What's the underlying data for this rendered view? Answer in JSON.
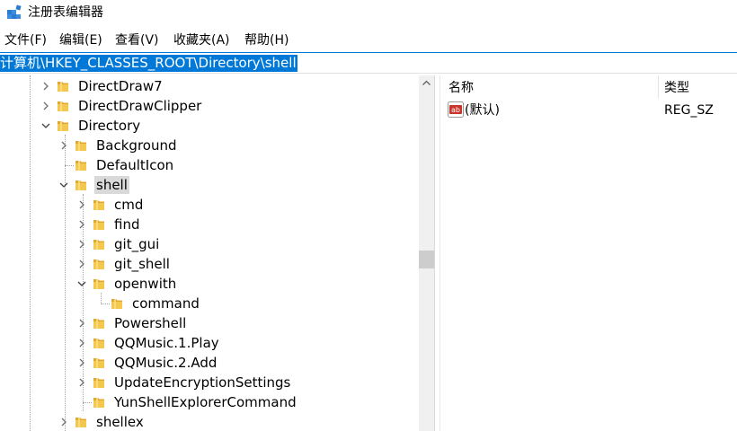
{
  "window": {
    "title": "注册表编辑器"
  },
  "menu": [
    "文件(F)",
    "编辑(E)",
    "查看(V)",
    "收藏夹(A)",
    "帮助(H)"
  ],
  "address": {
    "path": "计算机\\HKEY_CLASSES_ROOT\\Directory\\shell"
  },
  "tree": [
    {
      "label": "DirectDraw7",
      "expander": "collapsed",
      "level": 0
    },
    {
      "label": "DirectDrawClipper",
      "expander": "collapsed",
      "level": 0
    },
    {
      "label": "Directory",
      "expander": "expanded",
      "level": 0
    },
    {
      "label": "Background",
      "expander": "collapsed",
      "level": 1
    },
    {
      "label": "DefaultIcon",
      "expander": "none",
      "level": 1
    },
    {
      "label": "shell",
      "expander": "expanded",
      "level": 1,
      "selected": true
    },
    {
      "label": "cmd",
      "expander": "collapsed",
      "level": 2
    },
    {
      "label": "find",
      "expander": "collapsed",
      "level": 2
    },
    {
      "label": "git_gui",
      "expander": "collapsed",
      "level": 2
    },
    {
      "label": "git_shell",
      "expander": "collapsed",
      "level": 2
    },
    {
      "label": "openwith",
      "expander": "expanded",
      "level": 2
    },
    {
      "label": "command",
      "expander": "none",
      "level": 3
    },
    {
      "label": "Powershell",
      "expander": "collapsed",
      "level": 2
    },
    {
      "label": "QQMusic.1.Play",
      "expander": "collapsed",
      "level": 2
    },
    {
      "label": "QQMusic.2.Add",
      "expander": "collapsed",
      "level": 2
    },
    {
      "label": "UpdateEncryptionSettings",
      "expander": "collapsed",
      "level": 2
    },
    {
      "label": "YunShellExplorerCommand",
      "expander": "none",
      "level": 2
    },
    {
      "label": "shellex",
      "expander": "collapsed",
      "level": 1
    }
  ],
  "values": {
    "columns": {
      "name": "名称",
      "type": "类型"
    },
    "rows": [
      {
        "name": "(默认)",
        "type": "REG_SZ",
        "icon": "string-value-icon"
      }
    ]
  },
  "colors": {
    "selection": "#0078d7",
    "tree_selected": "#d9d9d9",
    "folder": "#f4c84c"
  }
}
